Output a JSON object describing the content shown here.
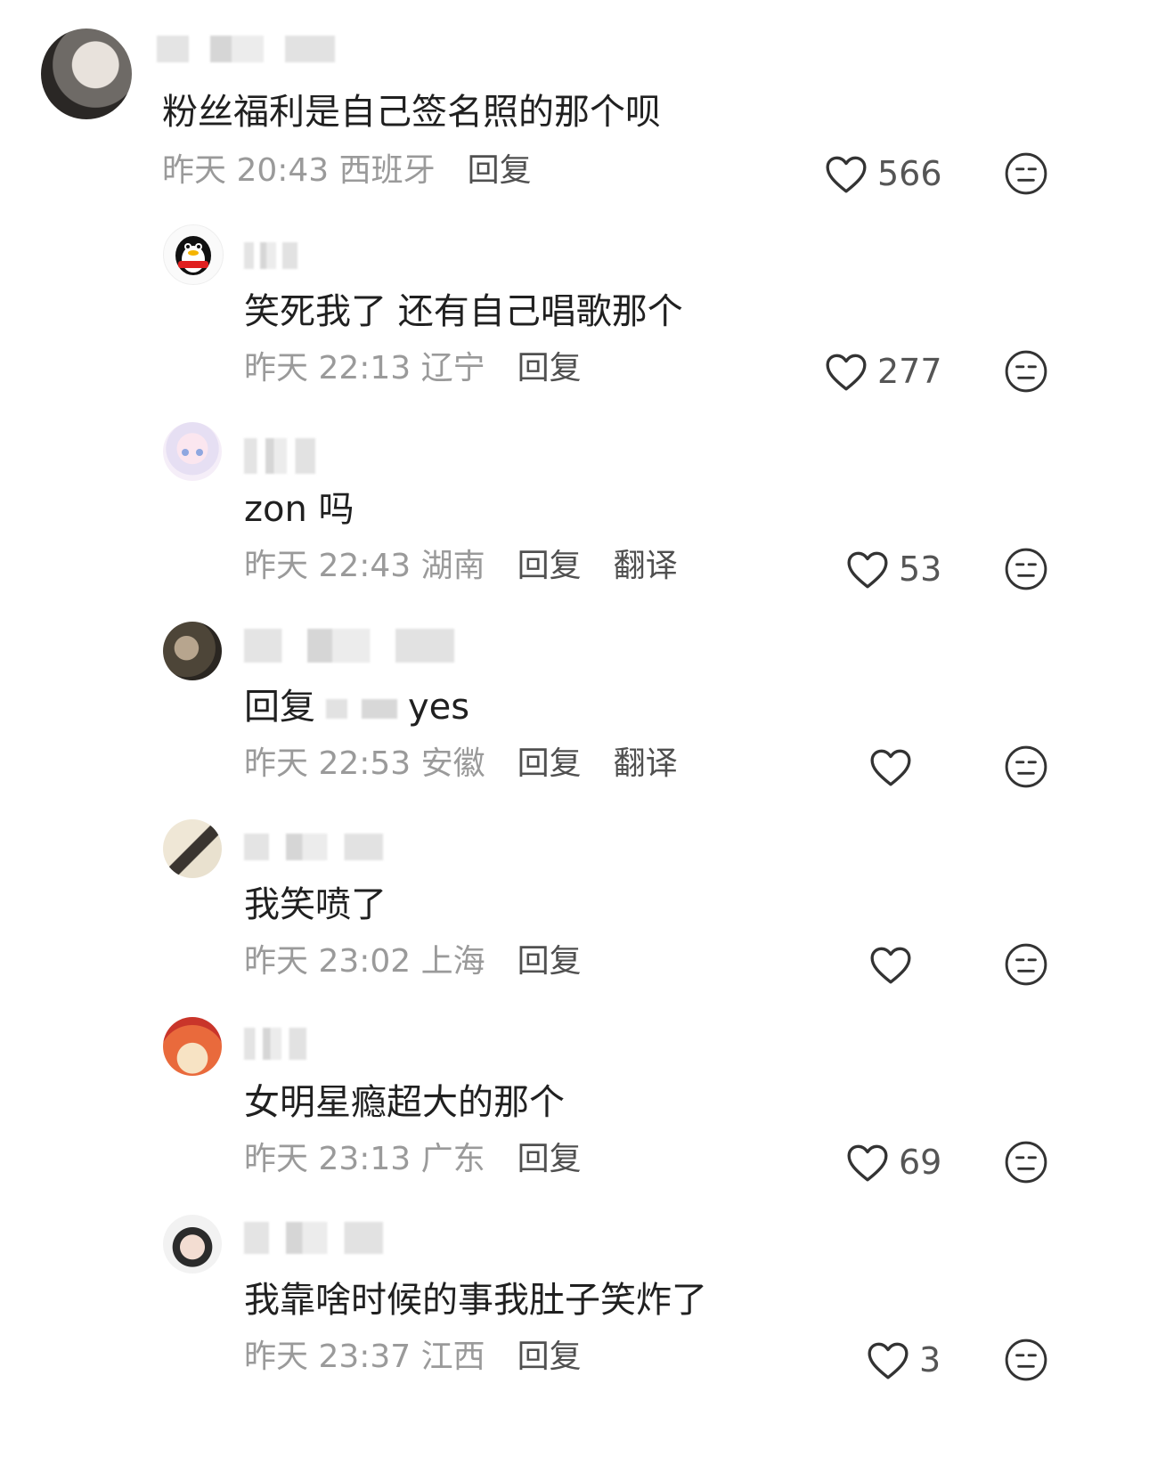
{
  "comments": [
    {
      "text": "粉丝福利是自己签名照的那个呗",
      "meta": "昨天 20:43 西班牙",
      "reply": "回复",
      "likes": "566",
      "avatar": "woman-photo"
    },
    {
      "text": "笑死我了 还有自己唱歌那个",
      "meta": "昨天 22:13 辽宁",
      "reply": "回复",
      "likes": "277",
      "avatar": "penguin"
    },
    {
      "text": "zon 吗",
      "meta": "昨天 22:43 湖南",
      "reply": "回复",
      "translate": "翻译",
      "likes": "53",
      "avatar": "anime-girl"
    },
    {
      "prefix": "回复",
      "text": "yes",
      "meta": "昨天 22:53 安徽",
      "reply": "回复",
      "translate": "翻译",
      "likes": "",
      "avatar": "photo-person"
    },
    {
      "text": "我笑喷了",
      "meta": "昨天 23:02 上海",
      "reply": "回复",
      "likes": "",
      "avatar": "photo-girl"
    },
    {
      "text": "女明星瘾超大的那个",
      "meta": "昨天 23:13 广东",
      "reply": "回复",
      "likes": "69",
      "avatar": "red-lanterns"
    },
    {
      "text": "我靠啥时候的事我肚子笑炸了",
      "meta": "昨天 23:37 江西",
      "reply": "回复",
      "likes": "3",
      "avatar": "sailor-girl"
    }
  ],
  "colors": {
    "meta": "#9a9a9a",
    "action": "#505050",
    "text": "#202020",
    "icon": "#333333"
  },
  "icons": {
    "like": "heart-outline-icon",
    "dislike": "neutral-face-icon"
  }
}
